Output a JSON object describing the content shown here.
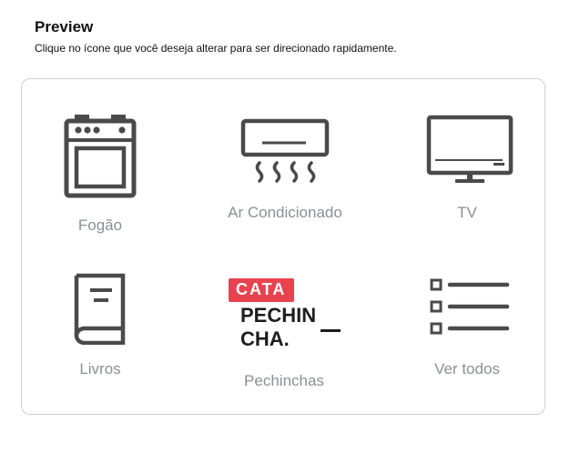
{
  "header": {
    "title": "Preview",
    "subtitle": "Clique no ícone que você deseja alterar para ser direcionado rapidamente."
  },
  "tiles": [
    {
      "label": "Fogão",
      "icon": "stove-icon"
    },
    {
      "label": "Ar Condicionado",
      "icon": "air-conditioner-icon"
    },
    {
      "label": "TV",
      "icon": "tv-icon"
    },
    {
      "label": "Livros",
      "icon": "book-icon"
    },
    {
      "label": "Pechinchas",
      "icon": "cata-pechincha-logo",
      "logo": {
        "badge": "CATA",
        "line1": "PECHIN",
        "line2": "CHA."
      }
    },
    {
      "label": "Ver todos",
      "icon": "list-icon"
    }
  ],
  "colors": {
    "icon": "#4a4a4a",
    "label": "#8b8f96",
    "badge": "#e8424f",
    "border": "#cfcfcf"
  }
}
